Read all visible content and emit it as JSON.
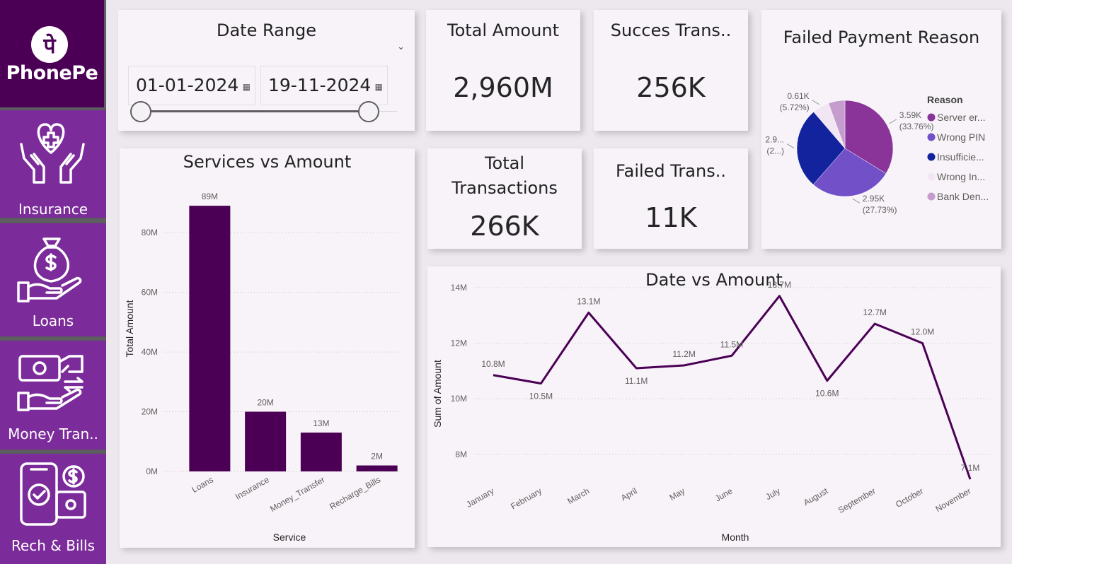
{
  "brand": {
    "name": "PhonePe",
    "glyph": "पे"
  },
  "sidebar": {
    "items": [
      {
        "label": "Insurance"
      },
      {
        "label": "Loans"
      },
      {
        "label": "Money Tran.."
      },
      {
        "label": "Rech & Bills"
      }
    ]
  },
  "date_range": {
    "title": "Date Range",
    "start": "01-01-2024",
    "end": "19-11-2024"
  },
  "kpis": {
    "total_amount": {
      "label": "Total Amount",
      "value": "2,960M"
    },
    "success_trans": {
      "label": "Succes Trans..",
      "value": "256K"
    },
    "total_transactions": {
      "label_line1": "Total",
      "label_line2": "Transactions",
      "value": "266K"
    },
    "failed_trans": {
      "label": "Failed Trans..",
      "value": "11K"
    }
  },
  "colors": {
    "accent_dark": "#4b0055",
    "accent": "#7b2c9a",
    "bar": "#4b0055",
    "line": "#4b0055"
  },
  "chart_data": [
    {
      "type": "pie",
      "title": "Failed Payment Reason",
      "legend_title": "Reason",
      "legend_position": "right",
      "slices": [
        {
          "label": "Server er...",
          "value": 3.59,
          "label_text": "3.59K",
          "pct_text": "(33.76%)",
          "color": "#8a3499"
        },
        {
          "label": "Wrong PIN",
          "value": 2.95,
          "label_text": "2.95K",
          "pct_text": "(27.73%)",
          "color": "#7150c8"
        },
        {
          "label": "Insufficie...",
          "value": 2.9,
          "label_text": "2.9...",
          "pct_text": "(2...)",
          "color": "#13239e"
        },
        {
          "label": "Wrong In...",
          "value": 0.61,
          "label_text": "0.61K",
          "pct_text": "(5.72%)",
          "color": "#f3e6f4"
        },
        {
          "label": "Bank Den...",
          "value": 0.59,
          "label_text": "",
          "pct_text": "",
          "color": "#c49ccd"
        }
      ]
    },
    {
      "type": "bar",
      "title": "Services vs Amount",
      "xlabel": "Service",
      "ylabel": "Total Amount",
      "categories": [
        "Loans",
        "Insurance",
        "Money_Transfer",
        "Recharge_Bills"
      ],
      "values": [
        89,
        20,
        13,
        2
      ],
      "data_labels": [
        "89M",
        "20M",
        "13M",
        "2M"
      ],
      "yticks": [
        0,
        20,
        40,
        60,
        80
      ],
      "ytick_labels": [
        "0M",
        "20M",
        "40M",
        "60M",
        "80M"
      ],
      "ylim": [
        0,
        94
      ],
      "grid": true
    },
    {
      "type": "line",
      "title": "Date vs Amount",
      "xlabel": "Month",
      "ylabel": "Sum of Amount",
      "categories": [
        "January",
        "February",
        "March",
        "April",
        "May",
        "June",
        "July",
        "August",
        "September",
        "October",
        "November"
      ],
      "values": [
        10.85,
        10.55,
        13.1,
        11.1,
        11.2,
        11.55,
        13.7,
        10.65,
        12.7,
        12.0,
        7.1
      ],
      "data_labels": [
        "10.8M",
        "10.5M",
        "13.1M",
        "11.1M",
        "11.2M",
        "11.5M",
        "13.7M",
        "10.6M",
        "12.7M",
        "12.0M",
        "7.1M"
      ],
      "yticks": [
        8,
        10,
        12,
        14
      ],
      "ytick_labels": [
        "8M",
        "10M",
        "12M",
        "14M"
      ],
      "ylim": [
        6.9,
        14
      ],
      "grid": true
    }
  ]
}
